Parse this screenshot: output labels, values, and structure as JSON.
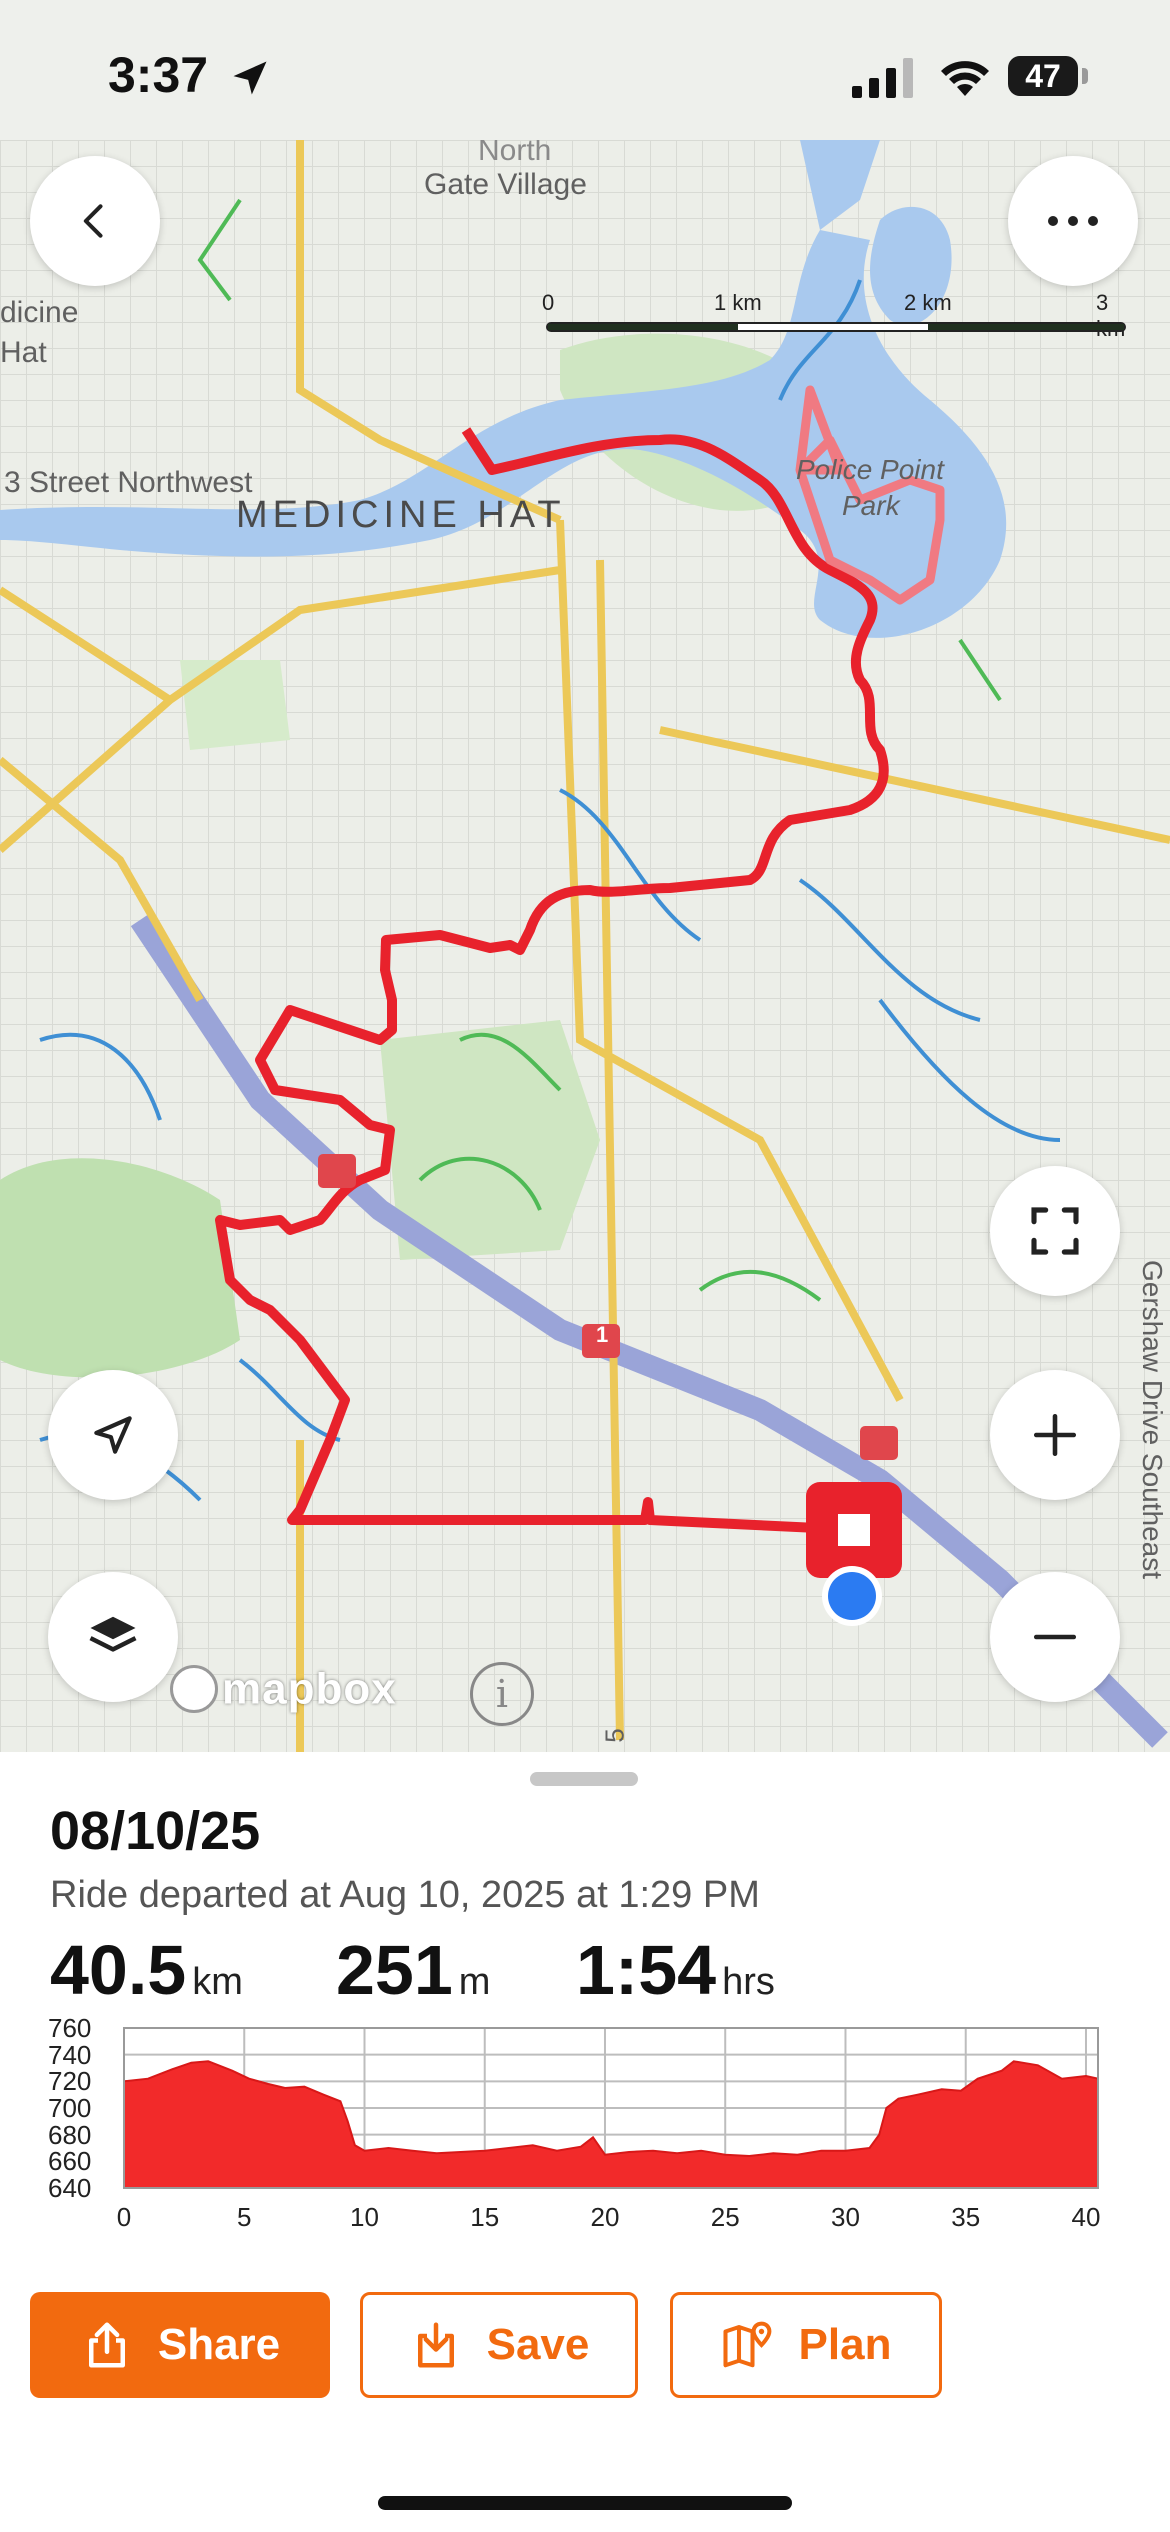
{
  "status": {
    "time": "3:37",
    "battery": "47"
  },
  "map": {
    "labels": {
      "area_top": "North",
      "gate_village": "Gate Village",
      "medicine_left": "dicine",
      "hat_left": "Hat",
      "street": "3 Street Northwest",
      "city": "MEDICINE HAT",
      "park1": "Police Point",
      "park2": "Park",
      "road_right": "Gershaw Drive Southeast",
      "highway": "1",
      "route_bottom": "5"
    },
    "scale": {
      "labels": [
        "0",
        "1 km",
        "2 km",
        "3 km"
      ]
    },
    "attribution": "mapbox",
    "route_color": "#e8222c"
  },
  "ride": {
    "date": "08/10/25",
    "subtitle": "Ride departed at Aug 10, 2025 at 1:29 PM",
    "distance": {
      "value": "40.5",
      "unit": "km"
    },
    "elevation": {
      "value": "251",
      "unit": "m"
    },
    "duration": {
      "value": "1:54",
      "unit": "hrs"
    }
  },
  "chart_data": {
    "type": "area",
    "title": "",
    "xlabel": "",
    "ylabel": "",
    "x_ticks": [
      "0",
      "5",
      "10",
      "15",
      "20",
      "25",
      "30",
      "35",
      "40"
    ],
    "y_ticks": [
      "760",
      "740",
      "720",
      "700",
      "680",
      "660",
      "640"
    ],
    "xlim": [
      0,
      40.5
    ],
    "ylim": [
      640,
      760
    ],
    "grid": true,
    "series": [
      {
        "color": "#f22a2a",
        "x": [
          0,
          1,
          2,
          2.8,
          3.5,
          4.5,
          5.2,
          6,
          6.7,
          7.5,
          8.3,
          9,
          9.3,
          9.6,
          10,
          11,
          12,
          13,
          14,
          15,
          16,
          17,
          18,
          19,
          19.5,
          20,
          21,
          22,
          23,
          24,
          25,
          26,
          27,
          28,
          29,
          30,
          31,
          31.4,
          31.7,
          32.2,
          33,
          34,
          34.8,
          35.5,
          36.5,
          37,
          38,
          39,
          40,
          40.5
        ],
        "y": [
          720,
          722,
          729,
          734,
          735,
          728,
          722,
          718,
          715,
          716,
          710,
          705,
          690,
          672,
          668,
          670,
          668,
          666,
          667,
          668,
          670,
          672,
          668,
          671,
          678,
          665,
          667,
          668,
          666,
          668,
          665,
          664,
          666,
          665,
          668,
          668,
          670,
          680,
          700,
          707,
          710,
          714,
          713,
          722,
          728,
          735,
          732,
          722,
          724,
          722
        ]
      }
    ]
  },
  "actions": {
    "share": "Share",
    "save": "Save",
    "plan": "Plan"
  }
}
